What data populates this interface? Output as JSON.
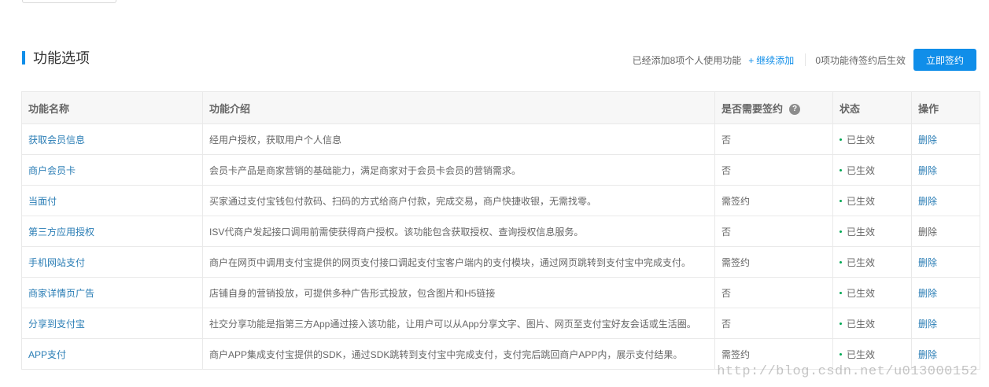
{
  "section": {
    "title": "功能选项",
    "added_text": "已经添加8项个人使用功能",
    "continue_add_label": "继续添加",
    "continue_add_icon": "plus-icon",
    "pending_text": "0项功能待签约后生效",
    "sign_button_label": "立即签约"
  },
  "colors": {
    "accent": "#108ee9",
    "link": "#2a7db5",
    "status_dot": "#00a854"
  },
  "table": {
    "headers": {
      "name": "功能名称",
      "intro": "功能介绍",
      "need_sign": "是否需要签约",
      "status": "状态",
      "action": "操作"
    },
    "help_icon": "?",
    "rows": [
      {
        "name": "获取会员信息",
        "intro": "经用户授权，获取用户个人信息",
        "sign": "否",
        "status": "已生效",
        "action": "删除",
        "action_enabled": true
      },
      {
        "name": "商户会员卡",
        "intro": "会员卡产品是商家营销的基础能力，满足商家对于会员卡会员的营销需求。",
        "sign": "否",
        "status": "已生效",
        "action": "删除",
        "action_enabled": true
      },
      {
        "name": "当面付",
        "intro": "买家通过支付宝钱包付款码、扫码的方式给商户付款，完成交易，商户快捷收银，无需找零。",
        "sign": "需签约",
        "status": "已生效",
        "action": "删除",
        "action_enabled": true
      },
      {
        "name": "第三方应用授权",
        "intro": "ISV代商户发起接口调用前需使获得商户授权。该功能包含获取授权、查询授权信息服务。",
        "sign": "否",
        "status": "已生效",
        "action": "删除",
        "action_enabled": false
      },
      {
        "name": "手机网站支付",
        "intro": "商户在网页中调用支付宝提供的网页支付接口调起支付宝客户端内的支付模块，通过网页跳转到支付宝中完成支付。",
        "sign": "需签约",
        "status": "已生效",
        "action": "删除",
        "action_enabled": true
      },
      {
        "name": "商家详情页广告",
        "intro": "店铺自身的营销投放，可提供多种广告形式投放，包含图片和H5链接",
        "sign": "否",
        "status": "已生效",
        "action": "删除",
        "action_enabled": true
      },
      {
        "name": "分享到支付宝",
        "intro": "社交分享功能是指第三方App通过接入该功能，让用户可以从App分享文字、图片、网页至支付宝好友会话或生活圈。",
        "sign": "否",
        "status": "已生效",
        "action": "删除",
        "action_enabled": true
      },
      {
        "name": "APP支付",
        "intro": "商户APP集成支付宝提供的SDK，通过SDK跳转到支付宝中完成支付，支付完后跳回商户APP内，展示支付结果。",
        "sign": "需签约",
        "status": "已生效",
        "action": "删除",
        "action_enabled": true
      }
    ]
  },
  "watermark": "http://blog.csdn.net/u013000152"
}
